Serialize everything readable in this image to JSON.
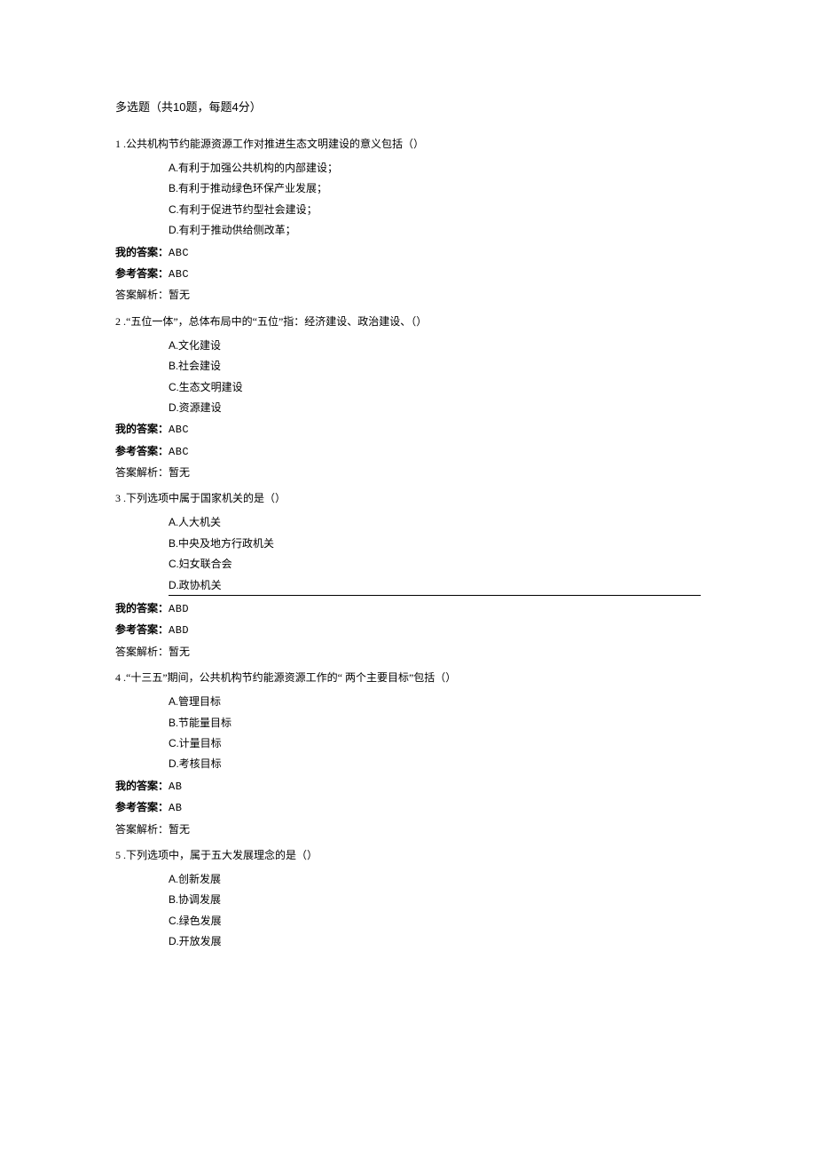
{
  "section": {
    "title_prefix": "多选题（共",
    "count": "10",
    "title_mid": "题，每题",
    "points": "4",
    "title_suffix": "分）"
  },
  "labels": {
    "my_answer": "我的答案：",
    "ref_answer": "参考答案：",
    "analysis_prefix": "答案解析：",
    "analysis_none": "暂无"
  },
  "questions": [
    {
      "num": "1",
      "stem": " .公共机构节约能源资源工作对推进生态文明建设的意义包括（）",
      "options": [
        {
          "letter": "A",
          "text": ".有利于加强公共机构的内部建设；"
        },
        {
          "letter": "B",
          "text": ".有利于推动绿色环保产业发展；"
        },
        {
          "letter": "C",
          "text": ".有利于促进节约型社会建设；"
        },
        {
          "letter": "D",
          "text": ".有利于推动供给侧改革；"
        }
      ],
      "my_answer": "ABC",
      "ref_answer": "ABC",
      "underline_last": false
    },
    {
      "num": "2",
      "stem": "  .“五位一体”，总体布局中的“五位”指：经济建设、政治建设、（）",
      "options": [
        {
          "letter": "A",
          "text": ".文化建设"
        },
        {
          "letter": "B",
          "text": ".社会建设"
        },
        {
          "letter": "C",
          "text": ".生态文明建设"
        },
        {
          "letter": "D",
          "text": ".资源建设"
        }
      ],
      "my_answer": "ABC",
      "ref_answer": "ABC",
      "underline_last": false
    },
    {
      "num": "3",
      "stem": "  .下列选项中属于国家机关的是（）",
      "options": [
        {
          "letter": "A",
          "text": ".人大机关"
        },
        {
          "letter": "B",
          "text": ".中央及地方行政机关"
        },
        {
          "letter": "C",
          "text": ".妇女联合会"
        },
        {
          "letter": "D",
          "text": ".政协机关"
        }
      ],
      "my_answer": "ABD",
      "ref_answer": "ABD",
      "underline_last": true
    },
    {
      "num": "4",
      "stem": "  .“十三五”期间，公共机构节约能源资源工作的“    两个主要目标”包括（）",
      "options": [
        {
          "letter": "A",
          "text": ".管理目标"
        },
        {
          "letter": "B",
          "text": ".节能量目标"
        },
        {
          "letter": "C",
          "text": ".计量目标"
        },
        {
          "letter": "D",
          "text": ".考核目标"
        }
      ],
      "my_answer": "AB",
      "ref_answer": "AB",
      "underline_last": false
    },
    {
      "num": "5",
      "stem": "  .下列选项中，属于五大发展理念的是（）",
      "options": [
        {
          "letter": "A",
          "text": ".创新发展"
        },
        {
          "letter": "B",
          "text": ".协调发展"
        },
        {
          "letter": "C",
          "text": ".绿色发展"
        },
        {
          "letter": "D",
          "text": ".开放发展"
        }
      ],
      "my_answer": null,
      "ref_answer": null,
      "underline_last": false
    }
  ]
}
